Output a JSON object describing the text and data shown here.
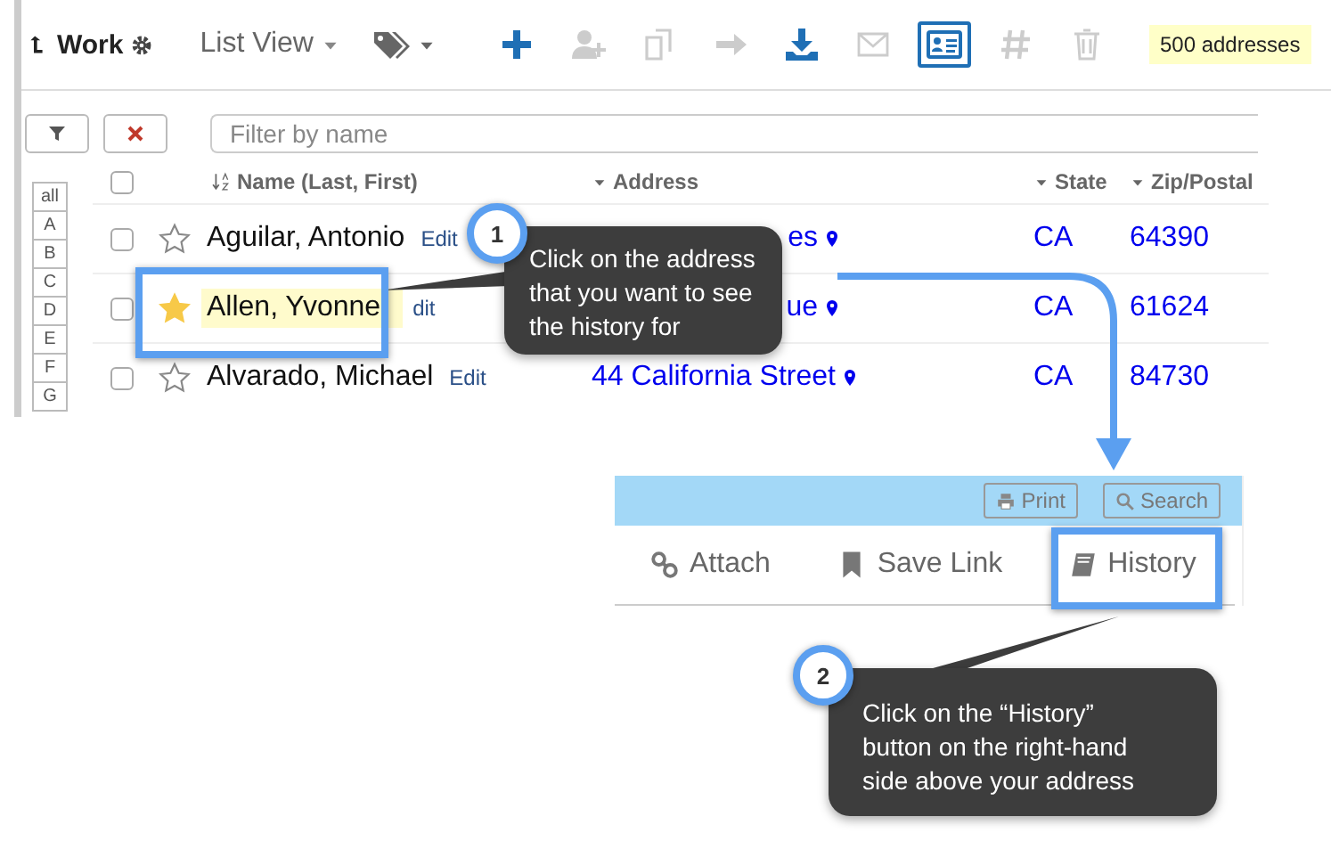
{
  "toolbar": {
    "folder": "Work",
    "view": "List View",
    "actions": [
      {
        "kind": "add",
        "disabled": false,
        "selected": false
      },
      {
        "kind": "add-contact",
        "disabled": true,
        "selected": false
      },
      {
        "kind": "copy",
        "disabled": true,
        "selected": false
      },
      {
        "kind": "forward",
        "disabled": true,
        "selected": false
      },
      {
        "kind": "download",
        "disabled": false,
        "selected": false
      },
      {
        "kind": "email",
        "disabled": true,
        "selected": false
      },
      {
        "kind": "card",
        "disabled": false,
        "selected": true
      },
      {
        "kind": "hash",
        "disabled": true,
        "selected": false
      },
      {
        "kind": "trash",
        "disabled": true,
        "selected": false
      }
    ],
    "count": "500 addresses"
  },
  "filter": {
    "placeholder": "Filter by name"
  },
  "index": [
    "all",
    "A",
    "B",
    "C",
    "D",
    "E",
    "F",
    "G"
  ],
  "table": {
    "all_checked": false,
    "columns": [
      "Name (Last, First)",
      "Address",
      "State",
      "Zip/Postal"
    ],
    "rows": [
      {
        "checked": false,
        "starred": false,
        "highlighted": false,
        "name": "Aguilar, Antonio",
        "edit": "Edit",
        "address": "es",
        "state": "CA",
        "zip": "64390"
      },
      {
        "checked": false,
        "starred": true,
        "highlighted": true,
        "name": "Allen, Yvonne",
        "edit": "dit",
        "address": "ue",
        "state": "CA",
        "zip": "61624"
      },
      {
        "checked": false,
        "starred": false,
        "highlighted": false,
        "name": "Alvarado, Michael",
        "edit": "Edit",
        "address": "44 California Street",
        "state": "CA",
        "zip": "84730"
      }
    ]
  },
  "detail_panel": {
    "buttons": [
      {
        "kind": "print",
        "label": "Print"
      },
      {
        "kind": "search",
        "label": "Search"
      }
    ],
    "tabs": [
      {
        "kind": "attach",
        "label": "Attach"
      },
      {
        "kind": "bookmark",
        "label": "Save Link"
      },
      {
        "kind": "history",
        "label": "History"
      }
    ]
  },
  "callouts": [
    {
      "number": "1",
      "text": "Click on the address that you want to see the history for"
    },
    {
      "number": "2",
      "text": "Click on the “History” button on the right-hand side above your address"
    }
  ]
}
